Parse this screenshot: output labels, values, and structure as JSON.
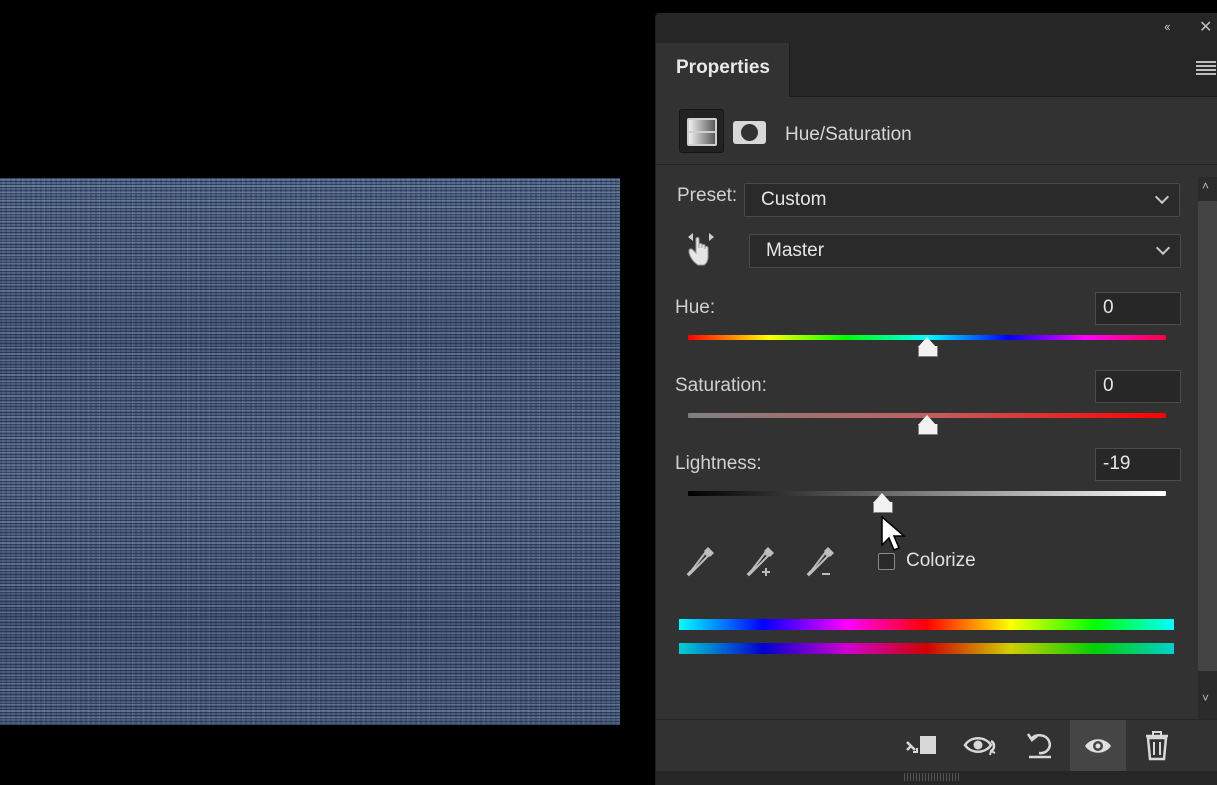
{
  "panel": {
    "tab_label": "Properties",
    "adjustment_title": "Hue/Saturation"
  },
  "preset": {
    "label": "Preset:",
    "value": "Custom"
  },
  "channel": {
    "value": "Master"
  },
  "sliders": {
    "hue": {
      "label": "Hue:",
      "value": "0",
      "fraction": 0.5
    },
    "saturation": {
      "label": "Saturation:",
      "value": "0",
      "fraction": 0.5
    },
    "lightness": {
      "label": "Lightness:",
      "value": "-19",
      "fraction": 0.405
    }
  },
  "colorize": {
    "label": "Colorize",
    "checked": false
  },
  "icons": {
    "header": [
      "collapse-panels-icon",
      "close-icon",
      "panel-menu-icon"
    ],
    "type": [
      "adjustment-icon",
      "mask-icon"
    ],
    "tools": [
      "targeted-adjustment-hand-icon",
      "eyedropper-icon",
      "eyedropper-add-icon",
      "eyedropper-subtract-icon"
    ],
    "footer": [
      "clip-to-layer-icon",
      "view-previous-state-icon",
      "reset-icon",
      "visibility-eye-icon",
      "trash-icon"
    ]
  },
  "colors": {
    "panel_bg": "#323232",
    "panel_header_bg": "#262626",
    "image_tint": "#4c6184"
  }
}
